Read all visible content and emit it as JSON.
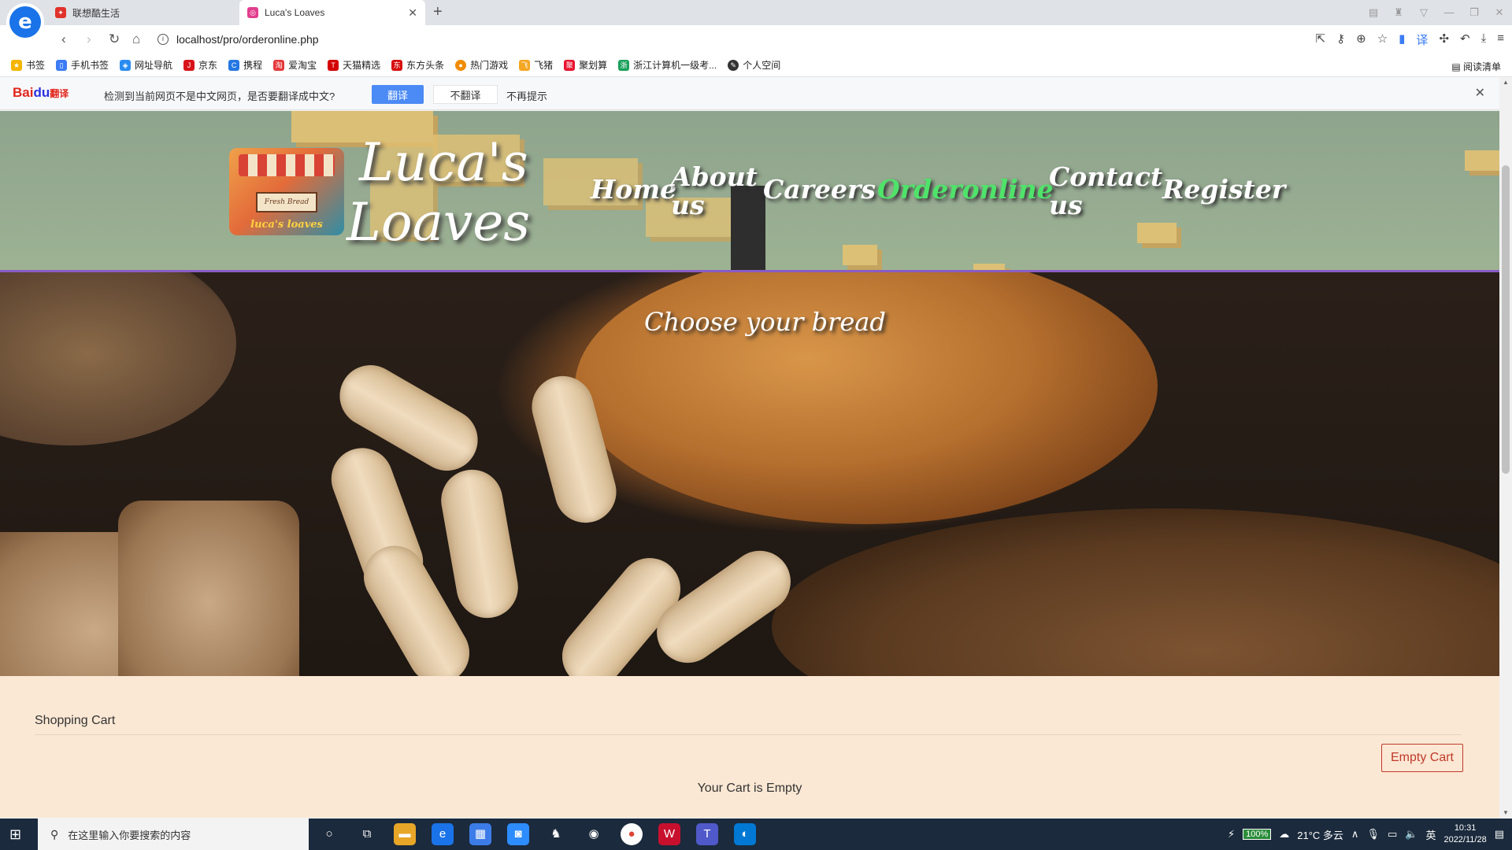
{
  "browser": {
    "logo": "e",
    "tabs": [
      {
        "title": "联想酷生活",
        "favicon": "red"
      },
      {
        "title": "Luca's Loaves",
        "favicon": "pink"
      }
    ],
    "new_tab": "+",
    "url": "localhost/pro/orderonline.php",
    "bookmarks": [
      {
        "label": "书签",
        "color": "#f5b400"
      },
      {
        "label": "手机书签",
        "color": "#3b7cf5"
      },
      {
        "label": "网址导航",
        "color": "#2a8cf0"
      },
      {
        "label": "京东",
        "color": "#d7141a"
      },
      {
        "label": "携程",
        "color": "#2577e3"
      },
      {
        "label": "爱淘宝",
        "color": "#e4393c"
      },
      {
        "label": "天猫精选",
        "color": "#d40000"
      },
      {
        "label": "东方头条",
        "color": "#d70f0f"
      },
      {
        "label": "热门游戏",
        "color": "#f08c00"
      },
      {
        "label": "飞猪",
        "color": "#f5a623"
      },
      {
        "label": "聚划算",
        "color": "#e8132f"
      },
      {
        "label": "浙江计算机一级考...",
        "color": "#1aa05a"
      },
      {
        "label": "个人空间",
        "color": "#333333"
      }
    ],
    "read_list": "阅读清单",
    "translate_bar": {
      "brand": "Bai",
      "brand_paw": "du",
      "brand_suffix": "翻译",
      "message": "检测到当前网页不是中文网页，是否要翻译成中文?",
      "translate_label": "翻译",
      "no_translate_label": "不翻译",
      "no_prompt_label": "不再提示"
    }
  },
  "site": {
    "name_line1": "Luca's",
    "name_line2": "Loaves",
    "logo_sign": "Fresh Bread",
    "logo_tagline": "luca's loaves",
    "nav": [
      {
        "label": "Home",
        "current": false
      },
      {
        "label": "About us",
        "current": false
      },
      {
        "label": "Careers",
        "current": false
      },
      {
        "label": "Orderonline",
        "current": true
      },
      {
        "label": "Contact us",
        "current": false
      },
      {
        "label": "Register",
        "current": false
      }
    ],
    "hero_title": "Choose your bread"
  },
  "cart": {
    "title": "Shopping Cart",
    "empty_button": "Empty Cart",
    "status": "Your Cart is Empty"
  },
  "taskbar": {
    "search_placeholder": "在这里输入你要搜索的内容",
    "battery": "100%",
    "weather": "21°C 多云",
    "ime": "英",
    "time": "10:31",
    "date": "2022/11/28"
  },
  "colors": {
    "nav_current": "#4fe36a",
    "empty_button": "#c0392b",
    "page_bg": "#fbe8d4",
    "header_line": "#8a5cc4"
  }
}
